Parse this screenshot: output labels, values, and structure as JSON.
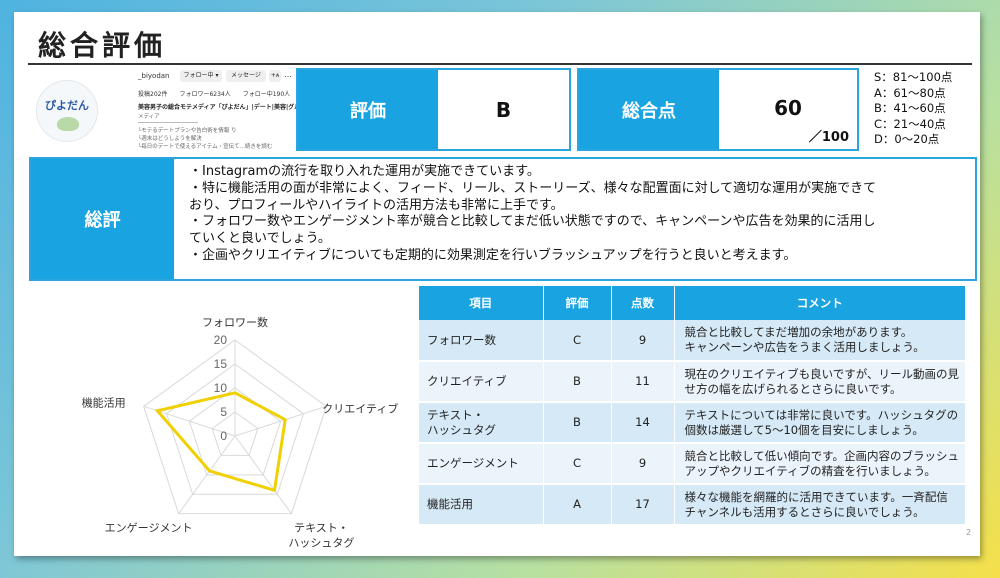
{
  "slide": {
    "title": "総合評価",
    "page_number": "2"
  },
  "profile": {
    "handle": "_biyodan",
    "follow_button": "フォロー中 ▾",
    "message_button": "メッセージ",
    "add_user_button": "+ᴀ",
    "more": "…",
    "stats": [
      "投稿202件",
      "フォロワー6234人",
      "フォロー中190人"
    ],
    "name_line": "美容男子の総合モテメディア「ぴよだん」|デート|美容|グルメ|",
    "lines": [
      "メディア",
      "└モテるデートプランや告白術を情報 り",
      "└週末はどうしようを解決",
      "└毎日のデートで使えるアイテム・宣伝て...続きを読む"
    ],
    "avatar_text": "ぴよだん",
    "avatar_icon": "bird-logo"
  },
  "evaluation": {
    "label": "評価",
    "value": "B"
  },
  "total_score": {
    "label": "総合点",
    "value": "60",
    "max": "／100"
  },
  "scale": [
    "S：81～100点",
    "A：61～80点",
    "B：41～60点",
    "C：21～40点",
    "D：0～20点"
  ],
  "summary": {
    "label": "総評",
    "lines": [
      "・Instagramの流行を取り入れた運用が実施できています。",
      "・特に機能活用の面が非常によく、フィード、リール、ストーリーズ、様々な配置面に対して適切な運用が実施できて",
      "おり、プロフィールやハイライトの活用方法も非常に上手です。",
      "・フォロワー数やエンゲージメント率が競合と比較してまだ低い状態ですので、キャンペーンや広告を効果的に活用し",
      "ていくと良いでしょう。",
      "・企画やクリエイティブについても定期的に効果測定を行いブラッシュアップを行うと良いと考えます。"
    ]
  },
  "chart_data": {
    "type": "radar",
    "categories": [
      "フォロワー数",
      "クリエイティブ",
      "テキスト・\nハッシュタグ",
      "エンゲージメント",
      "機能活用"
    ],
    "values": [
      9,
      11,
      14,
      9,
      17
    ],
    "rlim": [
      0,
      20
    ],
    "ticks": [
      "0",
      "5",
      "10",
      "15",
      "20"
    ],
    "series_color": "#f0d000",
    "grid_color": "#d9d9d9"
  },
  "table": {
    "headers": [
      "項目",
      "評価",
      "点数",
      "コメント"
    ],
    "rows": [
      {
        "item": "フォロワー数",
        "grade": "C",
        "score": "9",
        "comment": [
          "競合と比較してまだ増加の余地があります。",
          "キャンペーンや広告をうまく活用しましょう。"
        ]
      },
      {
        "item": "クリエイティブ",
        "grade": "B",
        "score": "11",
        "comment": [
          "現在のクリエイティブも良いですが、リール動画の見",
          "せ方の幅を広げられるとさらに良いです。"
        ]
      },
      {
        "item": "テキスト・\nハッシュタグ",
        "grade": "B",
        "score": "14",
        "comment": [
          "テキストについては非常に良いです。ハッシュタグの",
          "個数は厳選して5～10個を目安にしましょう。"
        ]
      },
      {
        "item": "エンゲージメント",
        "grade": "C",
        "score": "9",
        "comment": [
          "競合と比較して低い傾向です。企画内容のブラッシュ",
          "アップやクリエイティブの精査を行いましょう。"
        ]
      },
      {
        "item": "機能活用",
        "grade": "A",
        "score": "17",
        "comment": [
          "様々な機能を網羅的に活用できています。一斉配信",
          "チャンネルも活用するとさらに良いでしょう。"
        ]
      }
    ]
  },
  "colors": {
    "accent": "#19a3e0",
    "row_dark": "#d6e9f6",
    "row_light": "#ecf4fb"
  }
}
